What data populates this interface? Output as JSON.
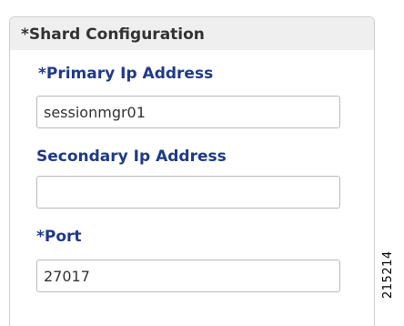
{
  "panel": {
    "title": "*Shard Configuration",
    "fields": [
      {
        "label": "*Primary Ip Address",
        "value": "sessionmgr01"
      },
      {
        "label": "Secondary Ip Address",
        "value": ""
      },
      {
        "label": "*Port",
        "value": "27017"
      }
    ]
  },
  "figure_id": "215214",
  "colors": {
    "label": "#1e3a8a",
    "header_bg": "#efefef",
    "border": "#cfcfcf"
  }
}
